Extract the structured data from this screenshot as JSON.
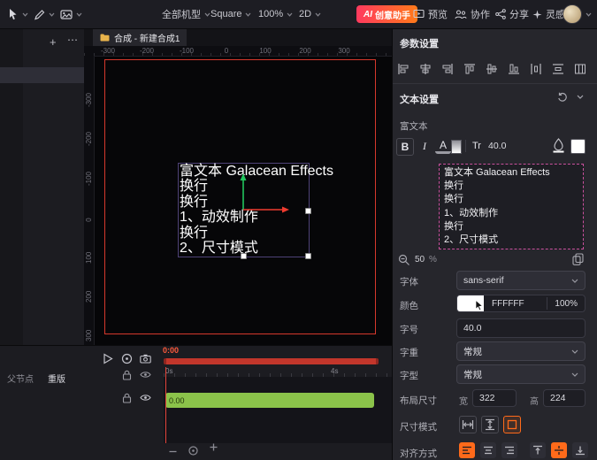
{
  "colors": {
    "accent_orange": "#ff6a1a",
    "ai_gradient_start": "#ff3a5e",
    "ai_gradient_end": "#ff7a1a",
    "composition_border": "#d5382c",
    "track_green": "#8bc34a",
    "selection_pink": "#c9509d",
    "playhead_red": "#e5443a"
  },
  "topbar": {
    "device_selector": "全部机型",
    "canvas_preset": "Square",
    "zoom_level": "100%",
    "dimension_mode": "2D",
    "ai_badge": "AI",
    "ai_label": "创意助手",
    "preview_label": "预览",
    "collaborate_label": "协作",
    "share_label": "分享",
    "inspiration_label": "灵感"
  },
  "canvas": {
    "tab_title": "合成 - 新建合成1",
    "ruler_h": [
      "-300",
      "-200",
      "-100",
      "0",
      "100",
      "200",
      "300"
    ],
    "ruler_v": [
      "-300",
      "-200",
      "-100",
      "0",
      "100",
      "200",
      "300"
    ],
    "text_lines": [
      "富文本 Galacean Effects",
      "换行",
      "换行",
      "1、动效制作",
      "换行",
      "2、尺寸模式"
    ]
  },
  "timeline": {
    "current_time": "0:00",
    "tick_start": "0s",
    "tick_end": "4s",
    "track_value": "0.00",
    "parent_node_label": "父节点",
    "parent_node_value": "重版"
  },
  "inspector": {
    "panel_title": "参数设置",
    "section_title": "文本设置",
    "rich_text_label": "富文本",
    "format": {
      "bold": "B",
      "italic": "I",
      "color": "A",
      "transform": "Tr",
      "size": "40.0"
    },
    "preview_lines": [
      "富文本 Galacean Effects",
      "换行",
      "换行",
      "1、动效制作",
      "换行",
      "2、尺寸模式"
    ],
    "preview_zoom": "50",
    "preview_zoom_unit": "%",
    "rows": {
      "font_label": "字体",
      "font_value": "sans-serif",
      "color_label": "颜色",
      "color_hex": "FFFFFF",
      "color_opacity": "100%",
      "size_label": "字号",
      "size_value": "40.0",
      "weight_label": "字重",
      "weight_value": "常规",
      "style_label": "字型",
      "style_value": "常规",
      "layout_label": "布局尺寸",
      "width_label": "宽",
      "width_value": "322",
      "height_label": "高",
      "height_value": "224",
      "size_mode_label": "尺寸模式",
      "align_label": "对齐方式"
    }
  }
}
